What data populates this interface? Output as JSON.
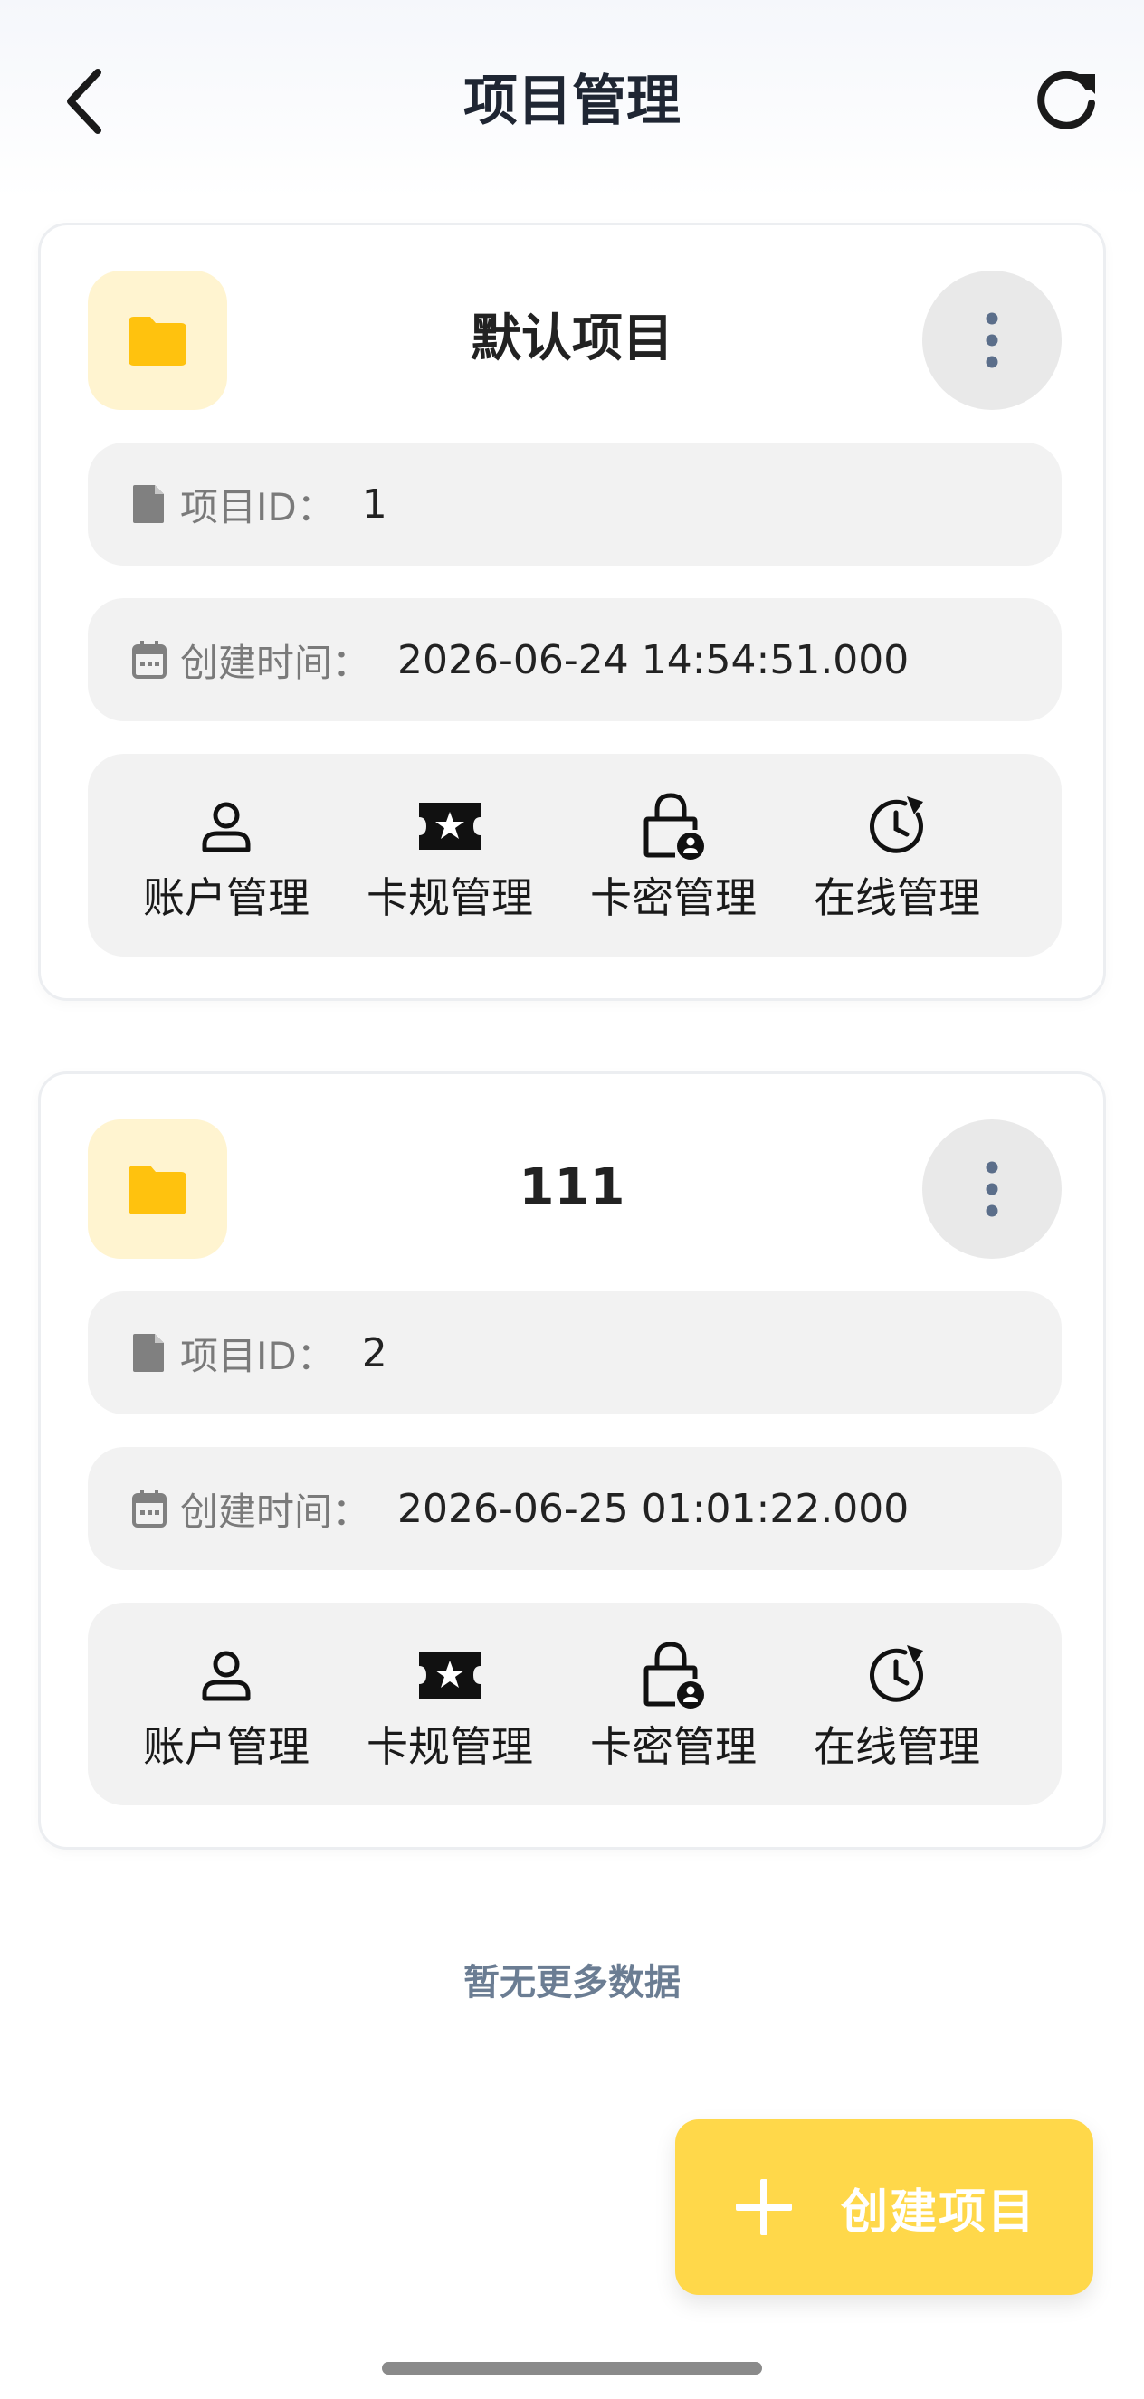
{
  "header": {
    "title": "项目管理",
    "back_icon": "chevron-left-icon",
    "refresh_icon": "refresh-icon"
  },
  "projects": [
    {
      "name": "默认项目",
      "id_label": "项目ID：",
      "id_value": "1",
      "time_label": "创建时间：",
      "time_value": "2026-06-24 14:54:51.000",
      "actions": [
        "账户管理",
        "卡规管理",
        "卡密管理",
        "在线管理"
      ]
    },
    {
      "name": "111",
      "id_label": "项目ID：",
      "id_value": "2",
      "time_label": "创建时间：",
      "time_value": "2026-06-25 01:01:22.000",
      "actions": [
        "账户管理",
        "卡规管理",
        "卡密管理",
        "在线管理"
      ]
    }
  ],
  "footer": {
    "no_more": "暂无更多数据"
  },
  "fab": {
    "label": "创建项目",
    "icon": "plus-icon"
  },
  "colors": {
    "accent": "#ffd84a",
    "folder": "#ffc20e",
    "folder_bg": "#fff4d0",
    "row_bg": "#f2f2f2",
    "more_dots": "#5b6e8a"
  }
}
